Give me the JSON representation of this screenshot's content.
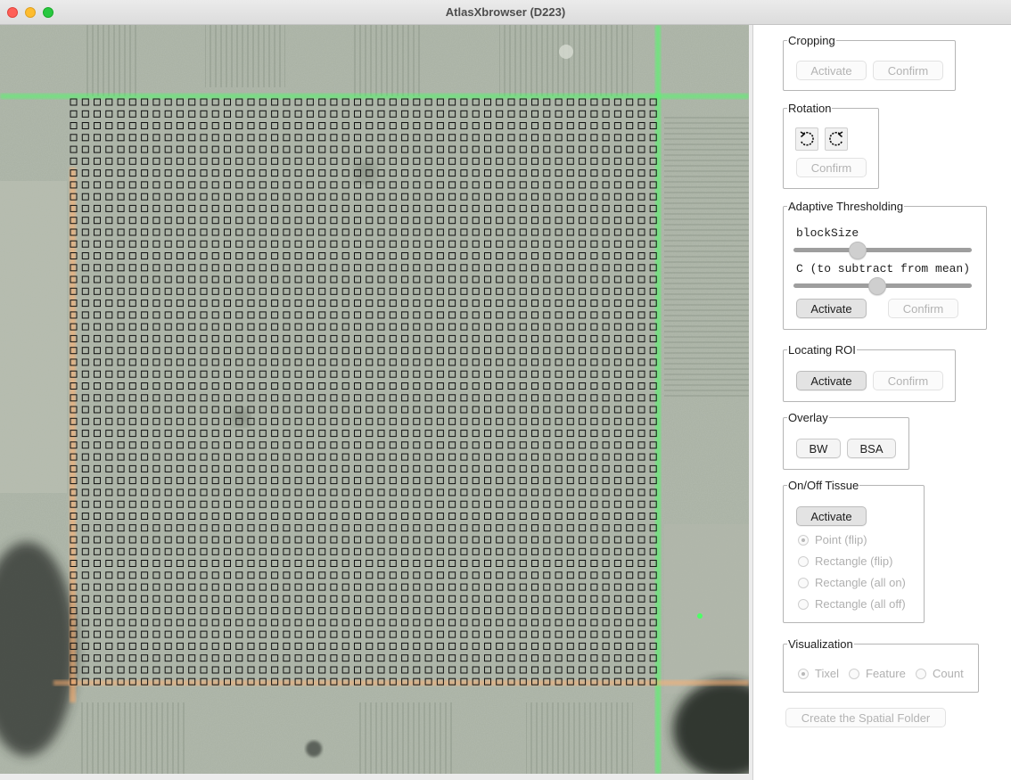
{
  "window": {
    "title": "AtlasXbrowser (D223)"
  },
  "canvas": {
    "grid_columns": 50,
    "grid_rows": 50
  },
  "colors": {
    "grid_square": "#111111",
    "green_line": "#4dff66",
    "orange_line": "#ffb070",
    "tissue_background": "#a8b0a2"
  },
  "cropping": {
    "legend": "Cropping",
    "activate": "Activate",
    "confirm": "Confirm"
  },
  "rotation": {
    "legend": "Rotation",
    "rotate_left_icon": "rotate-counterclockwise-icon",
    "rotate_right_icon": "rotate-clockwise-icon",
    "confirm": "Confirm"
  },
  "thresholding": {
    "legend": "Adaptive Thresholding",
    "blocksize_label": "blockSize",
    "c_label": "C (to subtract from mean)",
    "blocksize_level": 0.36,
    "c_level": 0.47,
    "activate": "Activate",
    "confirm": "Confirm"
  },
  "roi": {
    "legend": "Locating ROI",
    "activate": "Activate",
    "confirm": "Confirm"
  },
  "overlay": {
    "legend": "Overlay",
    "bw": "BW",
    "bsa": "BSA"
  },
  "tissue": {
    "legend": "On/Off Tissue",
    "activate": "Activate",
    "options": [
      "Point (flip)",
      "Rectangle (flip)",
      "Rectangle (all on)",
      "Rectangle (all off)"
    ],
    "selected": "Point (flip)"
  },
  "visualization": {
    "legend": "Visualization",
    "options": [
      "Tixel",
      "Feature",
      "Count"
    ],
    "selected": "Tixel"
  },
  "spatial_folder": {
    "label": "Create the Spatial Folder"
  }
}
